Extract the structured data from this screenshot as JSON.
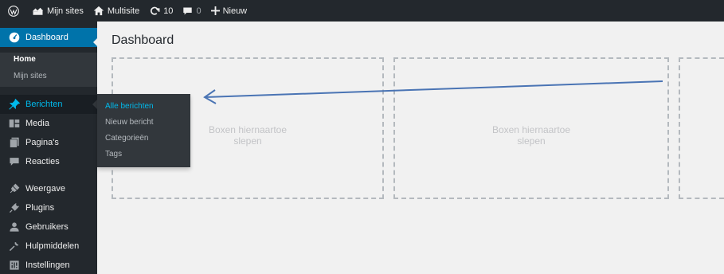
{
  "adminbar": {
    "wp_icon": "wordpress-logo-icon",
    "my_sites": "Mijn sites",
    "site_name": "Multisite",
    "updates_count": "10",
    "comments_count": "0",
    "new_label": "Nieuw"
  },
  "sidebar": {
    "dashboard": "Dashboard",
    "home": "Home",
    "my_sites": "Mijn sites",
    "items": [
      {
        "label": "Berichten",
        "icon": "pushpin-icon"
      },
      {
        "label": "Media",
        "icon": "media-icon"
      },
      {
        "label": "Pagina's",
        "icon": "pages-icon"
      },
      {
        "label": "Reacties",
        "icon": "comments-icon"
      },
      {
        "label": "Weergave",
        "icon": "appearance-icon"
      },
      {
        "label": "Plugins",
        "icon": "plugins-icon"
      },
      {
        "label": "Gebruikers",
        "icon": "users-icon"
      },
      {
        "label": "Hulpmiddelen",
        "icon": "tools-icon"
      },
      {
        "label": "Instellingen",
        "icon": "settings-icon"
      }
    ]
  },
  "flyout": {
    "items": [
      "Alle berichten",
      "Nieuw bericht",
      "Categorieën",
      "Tags"
    ]
  },
  "main": {
    "title": "Dashboard",
    "drop_line1": "Boxen hiernaartoe",
    "drop_line2": "slepen"
  },
  "colors": {
    "adminbar_bg": "#23282d",
    "accent": "#0073aa",
    "hover_text": "#00b9eb",
    "annotation_arrow": "#4a74b4"
  }
}
